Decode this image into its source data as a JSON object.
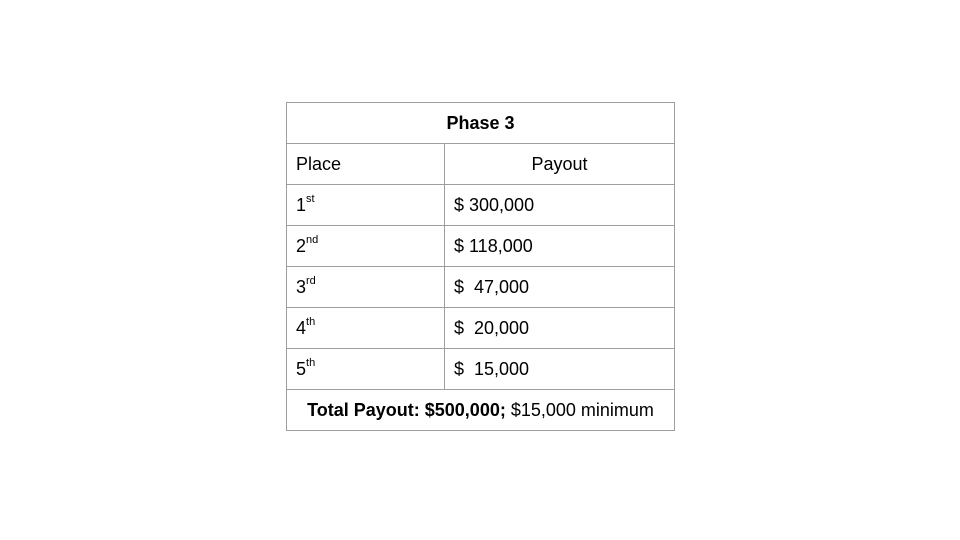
{
  "table": {
    "title": "Phase 3",
    "headers": {
      "place": "Place",
      "payout": "Payout"
    },
    "rows": [
      {
        "place_num": "1",
        "place_suffix": "st",
        "payout": "$ 300,000"
      },
      {
        "place_num": "2",
        "place_suffix": "nd",
        "payout": "$ 118,000"
      },
      {
        "place_num": "3",
        "place_suffix": "rd",
        "payout": "$  47,000"
      },
      {
        "place_num": "4",
        "place_suffix": "th",
        "payout": "$  20,000"
      },
      {
        "place_num": "5",
        "place_suffix": "th",
        "payout": "$  15,000"
      }
    ],
    "footer": {
      "bold_text": "Total Payout: $500,000;",
      "normal_text": " $15,000 minimum"
    }
  }
}
